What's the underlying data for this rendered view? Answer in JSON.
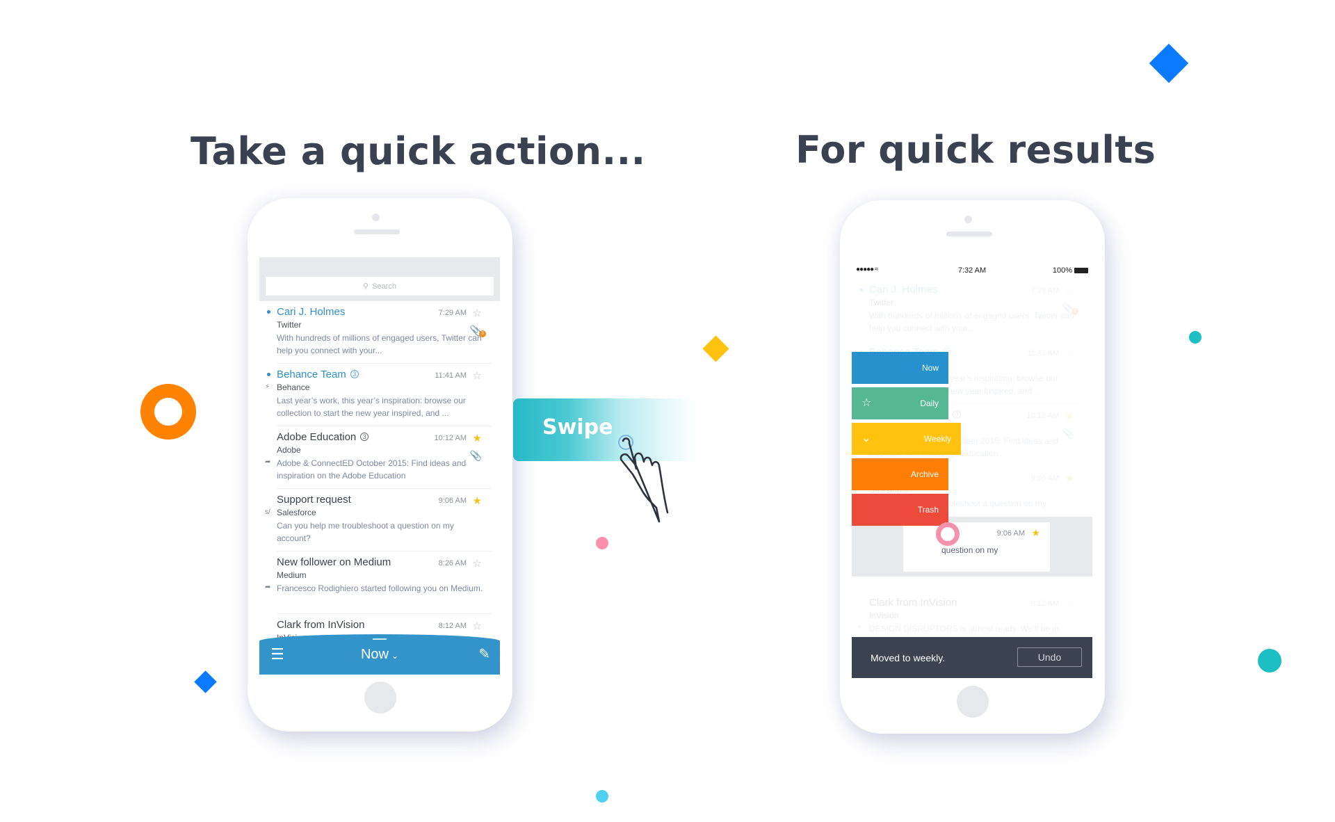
{
  "headings": {
    "left": "Take a quick action...",
    "right": "For quick results"
  },
  "colors": {
    "brand_blue": "#3294c9",
    "unread_blue": "#2f8fce",
    "star_yellow": "#f5c21a",
    "swipe_teal": "#27b9c6",
    "now": "#2691cc",
    "daily": "#55b893",
    "weekly": "#ffc20e",
    "archive": "#ff7e06",
    "trash": "#ec4b3b",
    "snackbar": "#3c4350"
  },
  "swipe_label": "Swipe",
  "phone_left": {
    "search": {
      "placeholder": "Search",
      "icon": "search-icon"
    },
    "emails": [
      {
        "sender": "Cari J. Holmes",
        "unread": true,
        "count": "",
        "time": "7:29 AM",
        "starred": false,
        "source": "Twitter",
        "preview": "With hundreds of millions of engaged users, Twitter can help you connect with your...",
        "side_icon": "",
        "attachment_badge": "3"
      },
      {
        "sender": "Behance Team",
        "unread": true,
        "count": "3",
        "time": "11:41 AM",
        "starred": false,
        "source": "Behance",
        "preview": "Last year’s work, this year’s inspiration: browse our collection to start the new year inspired, and ...",
        "side_icon": "bolt-reply-icon",
        "attachment_badge": ""
      },
      {
        "sender": "Adobe Education",
        "unread": false,
        "count": "3",
        "time": "10:12 AM",
        "starred": true,
        "source": "Adobe",
        "preview": "Adobe & ConnectED October 2015: Find ideas and inspiration on the Adobe Education",
        "side_icon": "reply-icon",
        "attachment_badge": ""
      },
      {
        "sender": "Support request",
        "unread": false,
        "count": "",
        "time": "9:06 AM",
        "starred": true,
        "source": "Salesforce",
        "preview": "Can you help me troubleshoot a question on my account?",
        "side_icon": "salesforce-icon",
        "attachment_badge": ""
      },
      {
        "sender": "New follower on Medium",
        "unread": false,
        "count": "",
        "time": "8:26 AM",
        "starred": false,
        "source": "Medium",
        "preview": "Francesco Rodighiero started following you on Medium.",
        "side_icon": "reply-icon",
        "attachment_badge": ""
      },
      {
        "sender": "Clark from InVision",
        "unread": false,
        "count": "",
        "time": "8:12 AM",
        "starred": false,
        "source": "InVision",
        "preview": "DESIGN DISRUPTORS is almost ready. We’ll be in touch when the full length film in available in",
        "side_icon": "bolt-icon",
        "attachment_badge": ""
      }
    ],
    "navbar": {
      "title": "Now",
      "menu_icon": "hamburger-icon",
      "compose_icon": "compose-icon"
    }
  },
  "phone_right": {
    "status_bar": {
      "signal": "●●●●●",
      "time": "7:32 AM",
      "battery": "100%"
    },
    "swiped_row": {
      "time": "9:06 AM",
      "preview": "question on my",
      "starred": true
    },
    "actions": [
      {
        "label": "Now",
        "icon": ""
      },
      {
        "label": "Daily",
        "icon": "star-icon"
      },
      {
        "label": "Weekly",
        "icon": "chevron-down-icon"
      },
      {
        "label": "Archive",
        "icon": ""
      },
      {
        "label": "Trash",
        "icon": ""
      }
    ],
    "snackbar": {
      "message": "Moved to weekly.",
      "action": "Undo"
    }
  }
}
